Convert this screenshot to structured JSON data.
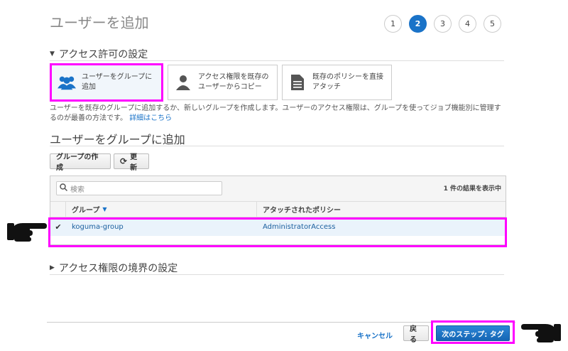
{
  "page": {
    "title": "ユーザーを追加",
    "steps": [
      "1",
      "2",
      "3",
      "4",
      "5"
    ],
    "active_step": "2"
  },
  "permissions": {
    "heading": "アクセス許可の設定",
    "options": [
      {
        "label": "ユーザーをグループに追加",
        "icon": "group-icon",
        "selected": true
      },
      {
        "label": "アクセス権限を既存のユーザーからコピー",
        "icon": "user-icon",
        "selected": false
      },
      {
        "label": "既存のポリシーを直接アタッチ",
        "icon": "document-icon",
        "selected": false
      }
    ],
    "description": "ユーザーを既存のグループに追加するか、新しいグループを作成します。ユーザーのアクセス権限は、グループを使ってジョブ機能別に管理するのが最善の方法です。",
    "details_link": "詳細はこちら"
  },
  "group_section": {
    "heading": "ユーザーをグループに追加",
    "create_button": "グループの作成",
    "refresh_button": "更新",
    "search_placeholder": "検索",
    "result_count": "1 件の結果を表示中",
    "columns": {
      "group": "グループ",
      "policy": "アタッチされたポリシー"
    },
    "rows": [
      {
        "group": "koguma-group",
        "policy": "AdministratorAccess",
        "checked": true
      }
    ]
  },
  "boundary": {
    "heading": "アクセス権限の境界の設定"
  },
  "footer": {
    "cancel": "キャンセル",
    "back": "戻る",
    "next": "次のステップ: タグ"
  },
  "colors": {
    "accent": "#1a73c8",
    "highlight": "#ff00ff",
    "selected_row": "#eaf3fb"
  }
}
